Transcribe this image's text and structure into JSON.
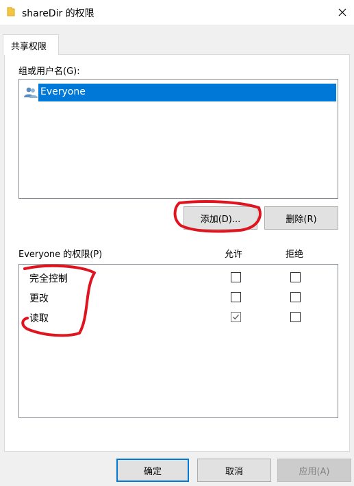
{
  "window": {
    "title": "shareDir 的权限",
    "folder_icon": "folder-icon",
    "close_icon": "close-icon"
  },
  "tabs": [
    {
      "label": "共享权限",
      "active": true
    }
  ],
  "group_section": {
    "label": "组或用户名(G):",
    "users": [
      {
        "name": "Everyone",
        "icon": "users-group-icon",
        "selected": true
      }
    ],
    "add_button": "添加(D)...",
    "remove_button": "删除(R)"
  },
  "permissions_section": {
    "label": "Everyone 的权限(P)",
    "allow_header": "允许",
    "deny_header": "拒绝",
    "rows": [
      {
        "name": "完全控制",
        "allow": false,
        "deny": false
      },
      {
        "name": "更改",
        "allow": false,
        "deny": false
      },
      {
        "name": "读取",
        "allow": true,
        "deny": false
      }
    ]
  },
  "footer": {
    "ok_button": "确定",
    "cancel_button": "取消",
    "apply_button": "应用(A)",
    "apply_disabled": true
  },
  "colors": {
    "selection": "#0078d7",
    "annotation": "#e0141e",
    "folder": "#f4c542"
  }
}
